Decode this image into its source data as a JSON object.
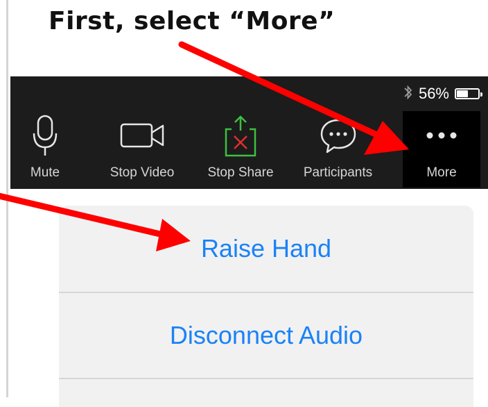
{
  "instruction": {
    "text": "First, select “More”"
  },
  "status": {
    "battery_percent_label": "56%",
    "battery_level": 0.56
  },
  "toolbar": {
    "items": [
      {
        "label": "Mute",
        "icon": "microphone-icon"
      },
      {
        "label": "Stop Video",
        "icon": "video-camera-icon"
      },
      {
        "label": "Stop Share",
        "icon": "stop-share-icon"
      },
      {
        "label": "Participants",
        "icon": "participants-icon"
      },
      {
        "label": "More",
        "icon": "ellipsis-icon"
      }
    ]
  },
  "menu": {
    "items": [
      {
        "label": "Raise Hand"
      },
      {
        "label": "Disconnect Audio"
      }
    ]
  },
  "colors": {
    "toolbar_bg": "#1c1c1c",
    "menu_text": "#1a82f7",
    "share_green": "#3fbf3f",
    "share_red": "#e0302a",
    "annotation_arrow": "#ff0000"
  }
}
